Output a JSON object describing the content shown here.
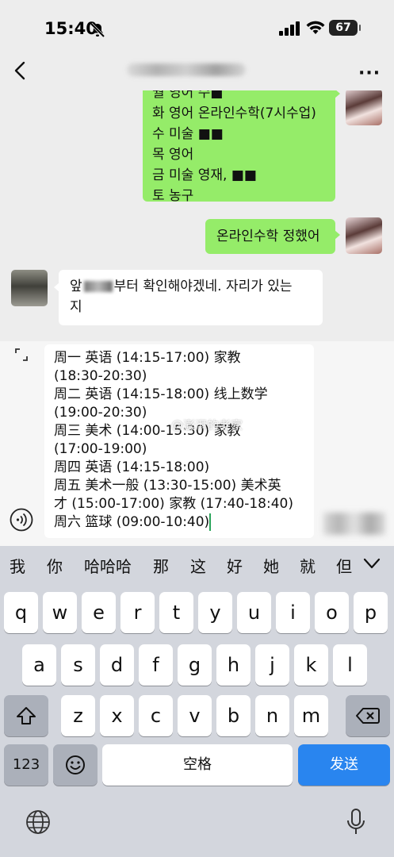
{
  "status": {
    "time": "15:40",
    "battery": "67"
  },
  "chat": {
    "messages": [
      {
        "from": "me",
        "lines": [
          "월 영어 수■",
          "화 영어 온라인수학(7시수업)",
          "수 미술 ■■",
          "목 영어",
          "금 미술 영재, ■■",
          "토 농구"
        ]
      },
      {
        "from": "me",
        "text": "온라인수학 정했어"
      },
      {
        "from": "other",
        "line1a": "앞",
        "line1b": "부터 확인해야겠네. 자리가 있는",
        "line2": "지"
      }
    ]
  },
  "composer": {
    "lines": [
      "周一 英语 (14:15-17:00) 家教",
      "(18:30-20:30)",
      "周二 英语 (14:15-18:00) 线上数学",
      "(19:00-20:30)",
      "周三 美术 (14:00-15:30) 家教",
      "(17:00-19:00)",
      "周四 英语 (14:15-18:00)",
      "周五 美术一般 (13:30-15:00) 美术英",
      "才 (15:00-17:00) 家教 (17:40-18:40)",
      "周六 篮球 (09:00-10:40)"
    ],
    "watermark": "@澎湃的老家"
  },
  "keyboard": {
    "candidates": [
      "我",
      "你",
      "哈哈哈",
      "那",
      "这",
      "好",
      "她",
      "就",
      "但"
    ],
    "row1": [
      "q",
      "w",
      "e",
      "r",
      "t",
      "y",
      "u",
      "i",
      "o",
      "p"
    ],
    "row2": [
      "a",
      "s",
      "d",
      "f",
      "g",
      "h",
      "j",
      "k",
      "l"
    ],
    "row3": [
      "z",
      "x",
      "c",
      "v",
      "b",
      "n",
      "m"
    ],
    "numbers_label": "123",
    "space_label": "空格",
    "send_label": "发送",
    "colors": {
      "send": "#2985ef",
      "bubble_me": "#95ec69"
    }
  }
}
